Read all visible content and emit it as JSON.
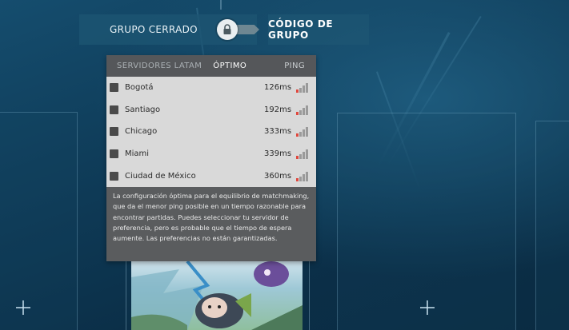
{
  "top_bar": {
    "closed_group_label": "GRUPO CERRADO",
    "group_code_label": "CÓDIGO DE GRUPO"
  },
  "server_panel": {
    "region_label": "SERVIDORES LATAM",
    "optimal_label": "ÓPTIMO",
    "ping_label": "PING",
    "servers": [
      {
        "city": "Bogotá",
        "ping": "126ms",
        "signal_level": 1
      },
      {
        "city": "Santiago",
        "ping": "192ms",
        "signal_level": 1
      },
      {
        "city": "Chicago",
        "ping": "333ms",
        "signal_level": 1
      },
      {
        "city": "Miami",
        "ping": "339ms",
        "signal_level": 1
      },
      {
        "city": "Ciudad de México",
        "ping": "360ms",
        "signal_level": 1
      }
    ],
    "description": "La configuración óptima para el equilibrio de matchmaking, que da el menor ping posible en un tiempo razonable para encontrar partidas. Puedes seleccionar tu servidor de preferencia, pero es probable que el tiempo de espera aumente. Las preferencias no están garantizadas."
  },
  "icons": {
    "lock": "lock-icon",
    "signal": "signal-bars-icon",
    "add": "plus-icon"
  },
  "colors": {
    "signal_weak": "#e0493f",
    "signal_off": "#9a9a9a",
    "panel_bg": "#5a5c5e",
    "rows_bg": "#d9d9d9"
  }
}
